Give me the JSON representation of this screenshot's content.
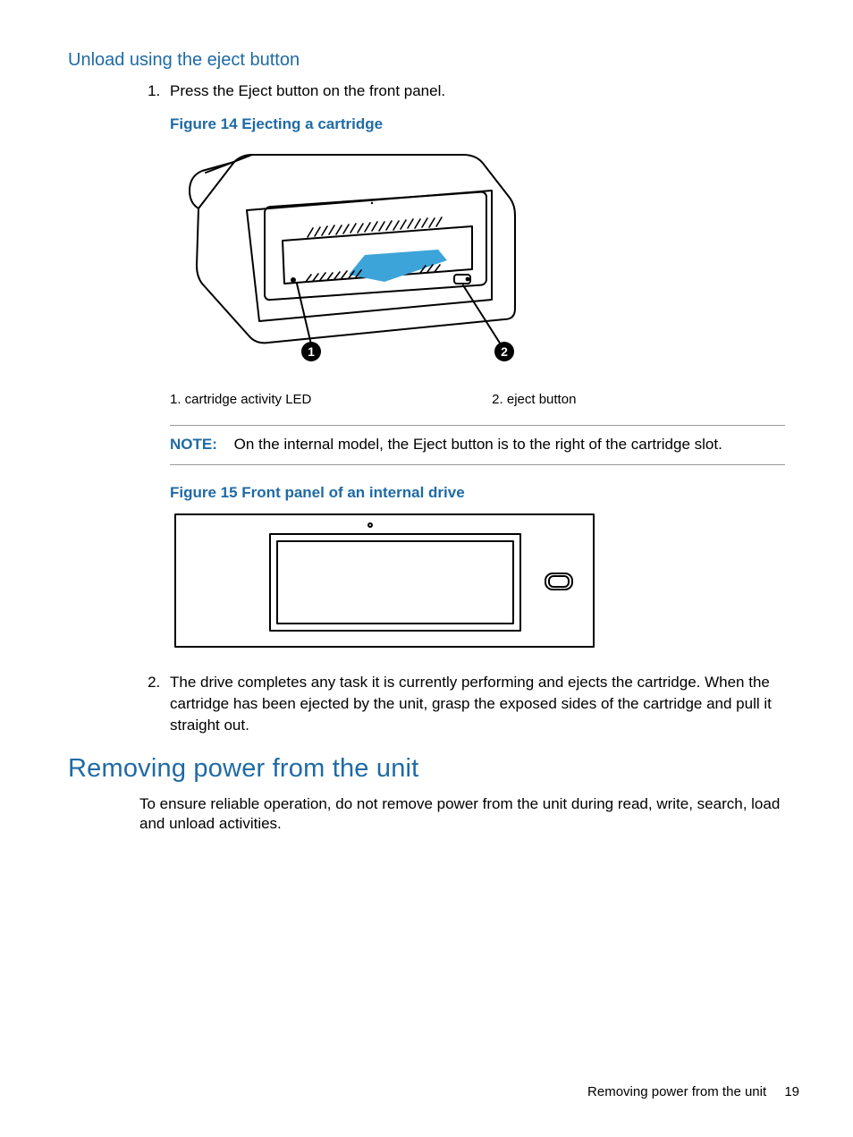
{
  "section1": {
    "heading": "Unload using the eject button",
    "steps": [
      "Press the Eject button on the front panel.",
      "The drive completes any task it is currently performing and ejects the cartridge. When the cartridge has been ejected by the unit, grasp the exposed sides of the cartridge and pull it straight out."
    ]
  },
  "figure14": {
    "caption": "Figure 14 Ejecting a cartridge",
    "callouts": [
      "1. cartridge activity LED",
      "2. eject button"
    ]
  },
  "note": {
    "label": "NOTE:",
    "text": "On the internal model, the Eject button is to the right of the cartridge slot."
  },
  "figure15": {
    "caption": "Figure 15 Front panel of an internal drive"
  },
  "section2": {
    "heading": "Removing power from the unit",
    "para": "To ensure reliable operation, do not remove power from the unit during read, write, search, load and unload activities."
  },
  "footer": {
    "label": "Removing power from the unit",
    "page": "19"
  }
}
